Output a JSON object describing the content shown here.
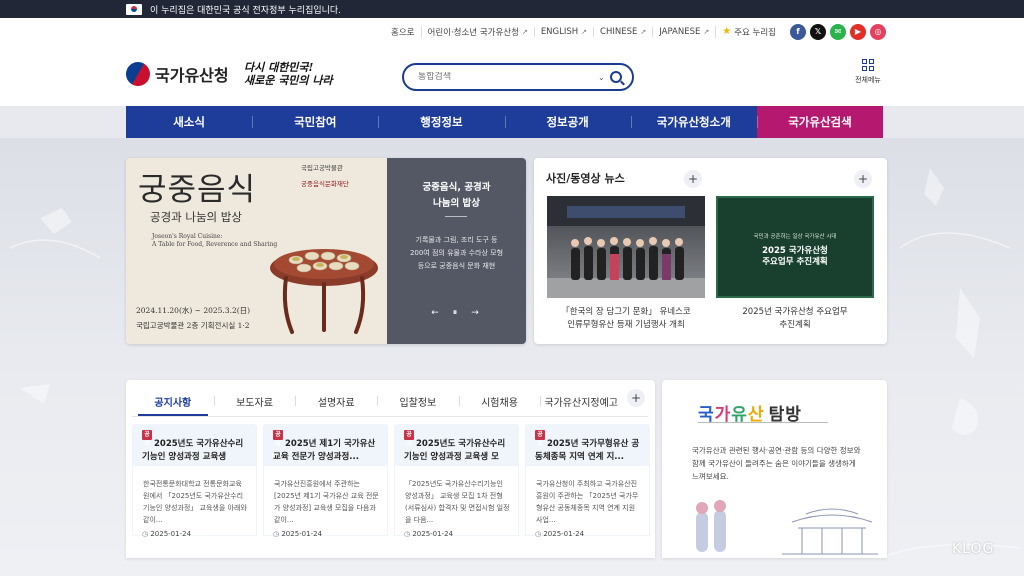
{
  "gov_banner": {
    "text": "이 누리집은 대한민국 공식 전자정부 누리집입니다."
  },
  "util_links": [
    {
      "label": "홈으로"
    },
    {
      "label": "어린이·청소년 국가유산청"
    },
    {
      "label": "ENGLISH"
    },
    {
      "label": "CHINESE"
    },
    {
      "label": "JAPANESE"
    },
    {
      "label": "주요 누리집"
    }
  ],
  "social": [
    {
      "name": "facebook",
      "glyph": "f",
      "color": "#3b5998"
    },
    {
      "name": "x",
      "glyph": "𝕏",
      "color": "#111111"
    },
    {
      "name": "kakao-story",
      "glyph": "✉",
      "color": "#2bb24c"
    },
    {
      "name": "youtube",
      "glyph": "▶",
      "color": "#e52d27"
    },
    {
      "name": "instagram",
      "glyph": "◎",
      "color": "#e4405f"
    }
  ],
  "header": {
    "logo_text": "국가유산청",
    "slogan_line1": "다시 대한민국!",
    "slogan_line2": "새로운 국민의 나라",
    "search_placeholder": "통합검색",
    "allmenu_label": "전체메뉴"
  },
  "nav": {
    "items": [
      {
        "label": "새소식"
      },
      {
        "label": "국민참여"
      },
      {
        "label": "행정정보"
      },
      {
        "label": "정보공개"
      },
      {
        "label": "국가유산청소개"
      },
      {
        "label": "국가유산검색"
      }
    ],
    "active": 5
  },
  "hero": {
    "title": "궁중음식",
    "subtitle": "공경과 나눔의 밥상",
    "english": "Joseon's Royal Cuisine:\nA Table for Food, Reverence and Sharing",
    "date": "2024.11.20(水) ~ 2025.3.2(日)",
    "venue": "국립고궁박물관 2층 기획전시실 1·2",
    "museum_name": "국립고궁박물관",
    "museum_sub": "궁중음식문화재단",
    "panel_title_1": "궁중음식, 공경과",
    "panel_title_2": "나눔의 밥상",
    "panel_desc_1": "기록물과 그림, 조리 도구 등",
    "panel_desc_2": "200여 점의 유물과 수라상 모형",
    "panel_desc_3": "등으로 궁중음식 문화 재현",
    "ctrl_prev": "←",
    "ctrl_pause": "⏸",
    "ctrl_next": "→"
  },
  "news": {
    "heading": "사진/동영상 뉴스",
    "cards": [
      {
        "caption_1": "「한국의 장 담그기 문화」 유네스코",
        "caption_2": "인류무형유산 등재 기념행사 개최"
      },
      {
        "caption_1": "2025년 국가유산청 주요업무",
        "caption_2": "추진계획",
        "thumb_small": "국민과 공존하는 일상 국가유산 시대",
        "thumb_big_1": "2025 국가유산청",
        "thumb_big_2": "주요업무 추진계획"
      }
    ]
  },
  "notice": {
    "tabs": [
      {
        "label": "공지사항"
      },
      {
        "label": "보도자료"
      },
      {
        "label": "설명자료"
      },
      {
        "label": "입찰정보"
      },
      {
        "label": "시험채용"
      },
      {
        "label": "국가유산지정예고"
      }
    ],
    "active_tab": 0,
    "badge": "공지",
    "cards": [
      {
        "title": "2025년도 국가유산수리기능인 양성과정 교육생",
        "body": "한국전통문화대학교 전통문화교육원에서 「2025년도 국가유산수리기능인 양성과정」 교육생을 아래와 같이...",
        "date": "2025-01-24"
      },
      {
        "title": "2025년 제1기 국가유산 교육 전문가 양성과정...",
        "body": "국가유산진흥원에서 주관하는 [2025년 제1기 국가유산 교육 전문가 양성과정] 교육생 모집을 다음과 같이...",
        "date": "2025-01-24"
      },
      {
        "title": "2025년도 국가유산수리기능인 양성과정 교육생 모",
        "body": "「2025년도 국가유산수리기능인 양성과정」 교육생 모집 1차 전형(서류심사) 합격자 및 면접시험 일정을 다음...",
        "date": "2025-01-24"
      },
      {
        "title": "2025년 국가무형유산 공동체종목 지역 연계 지...",
        "body": "국가유산청이 주최하고 국가유산진흥원이 주관하는 「2025년 국가무형유산 공동체종목 지역 연계 지원 사업...",
        "date": "2025-01-24"
      }
    ]
  },
  "tour": {
    "title_k1": "국",
    "title_k2": "가",
    "title_k3": "유",
    "title_k4": "산",
    "title_k5": "탐방",
    "desc": "국가유산과 관련된 행사·공연·관람 등의 다양한 정보와 함께 국가유산이 들려주는 숨은 이야기들을 생생하게 느껴보세요."
  },
  "watermark": {
    "text": "KLOG"
  }
}
